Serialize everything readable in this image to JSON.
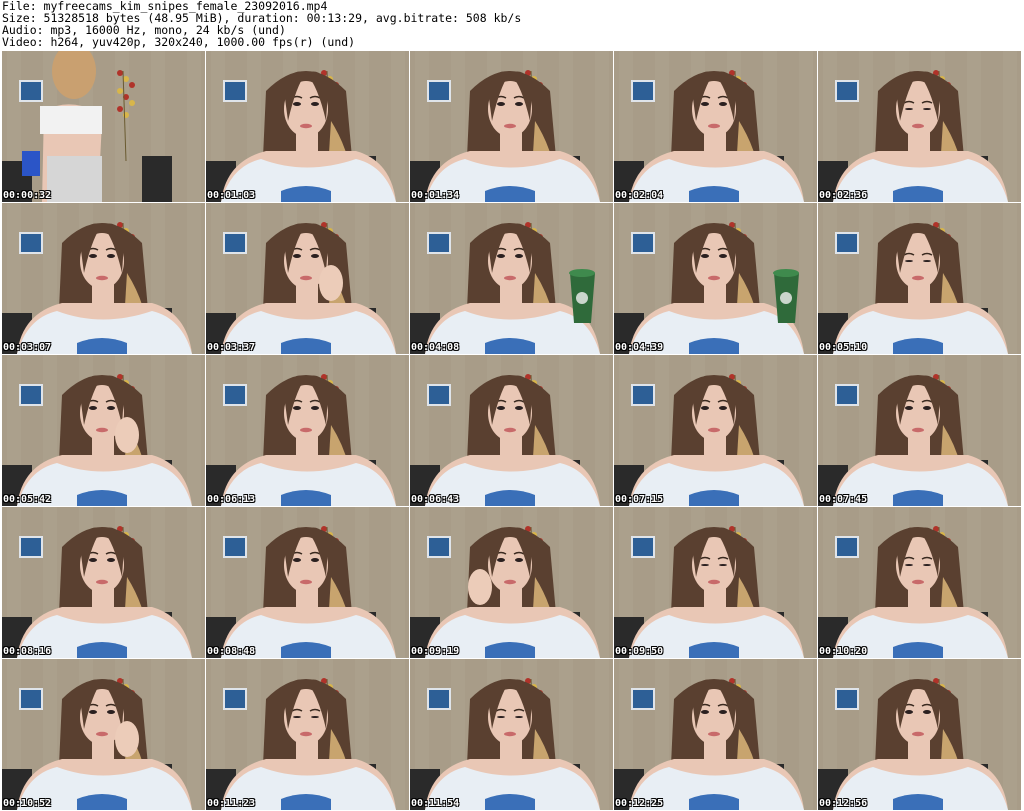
{
  "header": {
    "file": "File: myfreecams_kim_snipes_female_23092016.mp4",
    "size": "Size: 51328518 bytes (48.95 MiB), duration: 00:13:29, avg.bitrate: 508 kb/s",
    "audio": "Audio: mp3, 16000 Hz, mono, 24 kb/s (und)",
    "video": "Video: h264, yuv420p, 320x240, 1000.00 fps(r) (und)"
  },
  "thumbnails": [
    {
      "timestamp": "00:00:32",
      "variant": "standing"
    },
    {
      "timestamp": "00:01:03",
      "variant": "face"
    },
    {
      "timestamp": "00:01:34",
      "variant": "face"
    },
    {
      "timestamp": "00:02:04",
      "variant": "face"
    },
    {
      "timestamp": "00:02:36",
      "variant": "face-down"
    },
    {
      "timestamp": "00:03:07",
      "variant": "face"
    },
    {
      "timestamp": "00:03:37",
      "variant": "hand-face"
    },
    {
      "timestamp": "00:04:08",
      "variant": "cup"
    },
    {
      "timestamp": "00:04:39",
      "variant": "cup"
    },
    {
      "timestamp": "00:05:10",
      "variant": "face-down"
    },
    {
      "timestamp": "00:05:42",
      "variant": "hand-face"
    },
    {
      "timestamp": "00:06:13",
      "variant": "face"
    },
    {
      "timestamp": "00:06:43",
      "variant": "face"
    },
    {
      "timestamp": "00:07:15",
      "variant": "face"
    },
    {
      "timestamp": "00:07:45",
      "variant": "face"
    },
    {
      "timestamp": "00:08:16",
      "variant": "face"
    },
    {
      "timestamp": "00:08:48",
      "variant": "face"
    },
    {
      "timestamp": "00:09:19",
      "variant": "hand-face"
    },
    {
      "timestamp": "00:09:50",
      "variant": "face-down"
    },
    {
      "timestamp": "00:10:20",
      "variant": "face-down"
    },
    {
      "timestamp": "00:10:52",
      "variant": "hand-face"
    },
    {
      "timestamp": "00:11:23",
      "variant": "face-down"
    },
    {
      "timestamp": "00:11:54",
      "variant": "face-down"
    },
    {
      "timestamp": "00:12:25",
      "variant": "face"
    },
    {
      "timestamp": "00:12:56",
      "variant": "face"
    }
  ],
  "colors": {
    "wall": "#a89c88",
    "hair": "#5a4030",
    "skin": "#e9c7b5",
    "top": "#e8eef4",
    "cup": "#2f6a3a",
    "flowers": "#b0332a"
  }
}
